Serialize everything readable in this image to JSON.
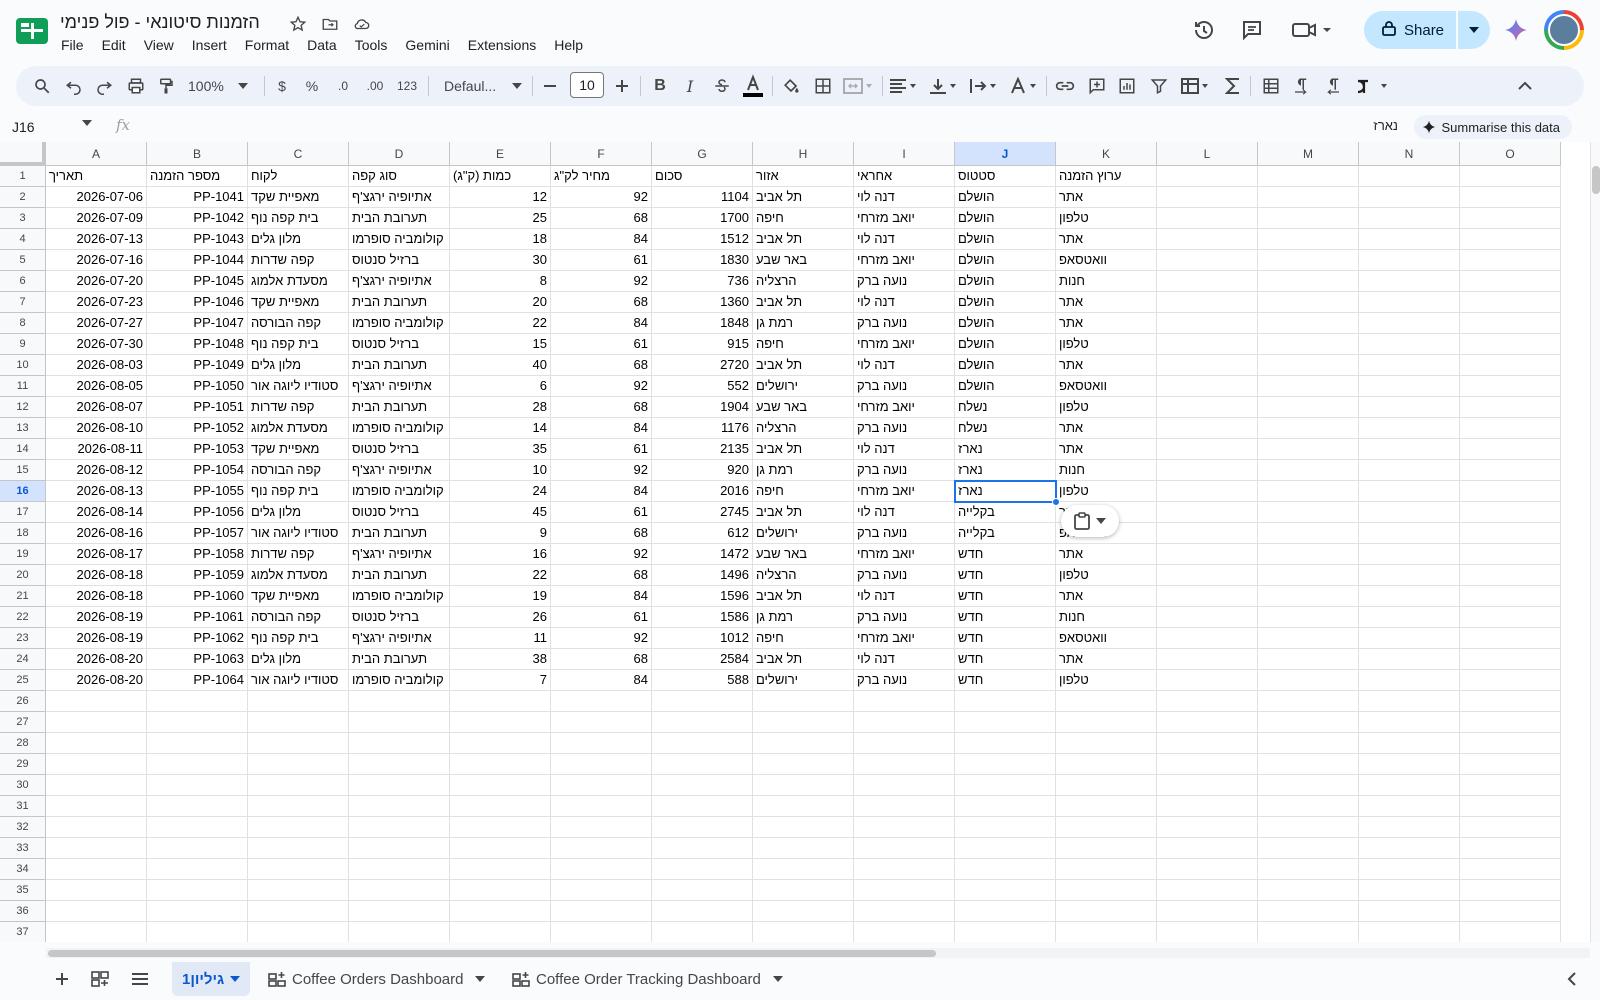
{
  "document": {
    "title": "הזמנות סיטונאי - פול פנימי",
    "title_icons": [
      "star-icon",
      "move-to-folder-icon",
      "cloud-saved-icon"
    ]
  },
  "menu": [
    "File",
    "Edit",
    "View",
    "Insert",
    "Format",
    "Data",
    "Tools",
    "Gemini",
    "Extensions",
    "Help"
  ],
  "header_actions": {
    "share_label": "Share"
  },
  "toolbar": {
    "zoom": "100%",
    "currency": "$",
    "percent": "%",
    "decrease_decimal": ".0",
    "increase_decimal": ".00",
    "number_format": "123",
    "font": "Defaul...",
    "font_size": "10",
    "bold": "B",
    "italic": "I"
  },
  "formula_bar": {
    "cell_ref": "J16",
    "fx": "fx",
    "value": "נארז",
    "summarise_label": "Summarise this data"
  },
  "grid": {
    "columns": [
      "A",
      "B",
      "C",
      "D",
      "E",
      "F",
      "G",
      "H",
      "I",
      "J",
      "K",
      "L",
      "M",
      "N",
      "O"
    ],
    "selected_column": "J",
    "selected_row": 16,
    "row_count": 37,
    "headers": [
      "תאריך",
      "מספר הזמנה",
      "לקוח",
      "סוג קפה",
      "כמות (ק\"ג)",
      "מחיר לק\"ג",
      "סכום",
      "אזור",
      "אחראי",
      "סטטוס",
      "ערוץ הזמנה"
    ],
    "rows": [
      [
        "2026-07-06",
        "PP-1041",
        "מאפיית שקד",
        "אתיופיה ירגצ'ף",
        "12",
        "92",
        "1104",
        "תל אביב",
        "דנה לוי",
        "הושלם",
        "אתר"
      ],
      [
        "2026-07-09",
        "PP-1042",
        "בית קפה נוף",
        "תערובת הבית",
        "25",
        "68",
        "1700",
        "חיפה",
        "יואב מזרחי",
        "הושלם",
        "טלפון"
      ],
      [
        "2026-07-13",
        "PP-1043",
        "מלון גלים",
        "קולומביה סופרמו",
        "18",
        "84",
        "1512",
        "תל אביב",
        "דנה לוי",
        "הושלם",
        "אתר"
      ],
      [
        "2026-07-16",
        "PP-1044",
        "קפה שדרות",
        "ברזיל סנטוס",
        "30",
        "61",
        "1830",
        "באר שבע",
        "יואב מזרחי",
        "הושלם",
        "וואטסאפ"
      ],
      [
        "2026-07-20",
        "PP-1045",
        "מסעדת אלמוג",
        "אתיופיה ירגצ'ף",
        "8",
        "92",
        "736",
        "הרצליה",
        "נועה ברק",
        "הושלם",
        "חנות"
      ],
      [
        "2026-07-23",
        "PP-1046",
        "מאפיית שקד",
        "תערובת הבית",
        "20",
        "68",
        "1360",
        "תל אביב",
        "דנה לוי",
        "הושלם",
        "אתר"
      ],
      [
        "2026-07-27",
        "PP-1047",
        "קפה הבורסה",
        "קולומביה סופרמו",
        "22",
        "84",
        "1848",
        "רמת גן",
        "נועה ברק",
        "הושלם",
        "אתר"
      ],
      [
        "2026-07-30",
        "PP-1048",
        "בית קפה נוף",
        "ברזיל סנטוס",
        "15",
        "61",
        "915",
        "חיפה",
        "יואב מזרחי",
        "הושלם",
        "טלפון"
      ],
      [
        "2026-08-03",
        "PP-1049",
        "מלון גלים",
        "תערובת הבית",
        "40",
        "68",
        "2720",
        "תל אביב",
        "דנה לוי",
        "הושלם",
        "אתר"
      ],
      [
        "2026-08-05",
        "PP-1050",
        "סטודיו ליוגה אור",
        "אתיופיה ירגצ'ף",
        "6",
        "92",
        "552",
        "ירושלים",
        "נועה ברק",
        "הושלם",
        "וואטסאפ"
      ],
      [
        "2026-08-07",
        "PP-1051",
        "קפה שדרות",
        "תערובת הבית",
        "28",
        "68",
        "1904",
        "באר שבע",
        "יואב מזרחי",
        "נשלח",
        "טלפון"
      ],
      [
        "2026-08-10",
        "PP-1052",
        "מסעדת אלמוג",
        "קולומביה סופרמו",
        "14",
        "84",
        "1176",
        "הרצליה",
        "נועה ברק",
        "נשלח",
        "אתר"
      ],
      [
        "2026-08-11",
        "PP-1053",
        "מאפיית שקד",
        "ברזיל סנטוס",
        "35",
        "61",
        "2135",
        "תל אביב",
        "דנה לוי",
        "נארז",
        "אתר"
      ],
      [
        "2026-08-12",
        "PP-1054",
        "קפה הבורסה",
        "אתיופיה ירגצ'ף",
        "10",
        "92",
        "920",
        "רמת גן",
        "נועה ברק",
        "נארז",
        "חנות"
      ],
      [
        "2026-08-13",
        "PP-1055",
        "בית קפה נוף",
        "קולומביה סופרמו",
        "24",
        "84",
        "2016",
        "חיפה",
        "יואב מזרחי",
        "נארז",
        "טלפון"
      ],
      [
        "2026-08-14",
        "PP-1056",
        "מלון גלים",
        "ברזיל סנטוס",
        "45",
        "61",
        "2745",
        "תל אביב",
        "דנה לוי",
        "בקלייה",
        "אתר"
      ],
      [
        "2026-08-16",
        "PP-1057",
        "סטודיו ליוגה אור",
        "תערובת הבית",
        "9",
        "68",
        "612",
        "ירושלים",
        "נועה ברק",
        "בקלייה",
        "וואטסאפ"
      ],
      [
        "2026-08-17",
        "PP-1058",
        "קפה שדרות",
        "אתיופיה ירגצ'ף",
        "16",
        "92",
        "1472",
        "באר שבע",
        "יואב מזרחי",
        "חדש",
        "אתר"
      ],
      [
        "2026-08-18",
        "PP-1059",
        "מסעדת אלמוג",
        "תערובת הבית",
        "22",
        "68",
        "1496",
        "הרצליה",
        "נועה ברק",
        "חדש",
        "טלפון"
      ],
      [
        "2026-08-18",
        "PP-1060",
        "מאפיית שקד",
        "קולומביה סופרמו",
        "19",
        "84",
        "1596",
        "תל אביב",
        "דנה לוי",
        "חדש",
        "אתר"
      ],
      [
        "2026-08-19",
        "PP-1061",
        "קפה הבורסה",
        "ברזיל סנטוס",
        "26",
        "61",
        "1586",
        "רמת גן",
        "נועה ברק",
        "חדש",
        "חנות"
      ],
      [
        "2026-08-19",
        "PP-1062",
        "בית קפה נוף",
        "אתיופיה ירגצ'ף",
        "11",
        "92",
        "1012",
        "חיפה",
        "יואב מזרחי",
        "חדש",
        "וואטסאפ"
      ],
      [
        "2026-08-20",
        "PP-1063",
        "מלון גלים",
        "תערובת הבית",
        "38",
        "68",
        "2584",
        "תל אביב",
        "דנה לוי",
        "חדש",
        "אתר"
      ],
      [
        "2026-08-20",
        "PP-1064",
        "סטודיו ליוגה אור",
        "קולומביה סופרמו",
        "7",
        "84",
        "588",
        "ירושלים",
        "נועה ברק",
        "חדש",
        "טלפון"
      ]
    ]
  },
  "sheets": [
    {
      "label": "גיליון1",
      "active": true,
      "icon": ""
    },
    {
      "label": "Coffee Orders Dashboard",
      "active": false,
      "icon": "dashboard-icon"
    },
    {
      "label": "Coffee Order Tracking Dashboard",
      "active": false,
      "icon": "dashboard-icon"
    }
  ],
  "colors": {
    "accent": "#1a73e8",
    "share_bg": "#c2e7ff",
    "toolbar_bg": "#edf2fa",
    "selected_header_bg": "#d3e3fd"
  }
}
